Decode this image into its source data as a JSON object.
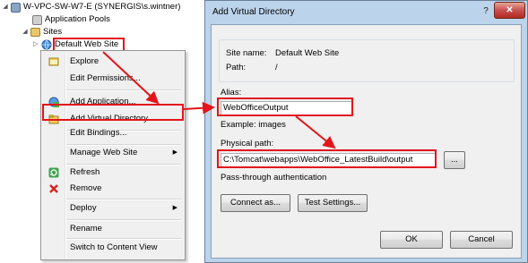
{
  "tree": {
    "server": "W-VPC-SW-W7-E (SYNERGIS\\s.wintner)",
    "app_pools": "Application Pools",
    "sites": "Sites",
    "default_site": "Default Web Site"
  },
  "context_menu": {
    "items": [
      {
        "label": "Explore",
        "icon": "explore-icon"
      },
      {
        "label": "Edit Permissions...",
        "icon": ""
      },
      {
        "label": "Add Application...",
        "icon": "add-application-icon"
      },
      {
        "label": "Add Virtual Directory...",
        "icon": "add-virtual-directory-icon"
      },
      {
        "label": "Edit Bindings...",
        "icon": ""
      },
      {
        "label": "Manage Web Site",
        "icon": "",
        "submenu": true
      },
      {
        "label": "Refresh",
        "icon": "refresh-icon"
      },
      {
        "label": "Remove",
        "icon": "remove-icon"
      },
      {
        "label": "Deploy",
        "icon": "",
        "submenu": true
      },
      {
        "label": "Rename",
        "icon": ""
      },
      {
        "label": "Switch to Content View",
        "icon": ""
      }
    ]
  },
  "dialog": {
    "title": "Add Virtual Directory",
    "help_glyph": "?",
    "close_glyph": "✕",
    "site_name_label": "Site name:",
    "site_name_value": "Default Web Site",
    "path_label": "Path:",
    "path_value": "/",
    "alias_label": "Alias:",
    "alias_value": "WebOfficeOutput",
    "example_text": "Example: images",
    "physical_path_label": "Physical path:",
    "physical_path_value": "C:\\Tomcat\\webapps\\WebOffice_LatestBuild\\output",
    "browse_label": "...",
    "passthrough_text": "Pass-through authentication",
    "connect_as_label": "Connect as...",
    "test_settings_label": "Test Settings...",
    "ok_label": "OK",
    "cancel_label": "Cancel"
  },
  "colors": {
    "highlight_red": "#e3141b",
    "dialog_frame": "#bcd3ec",
    "menu_bg": "#f0f0f0"
  }
}
